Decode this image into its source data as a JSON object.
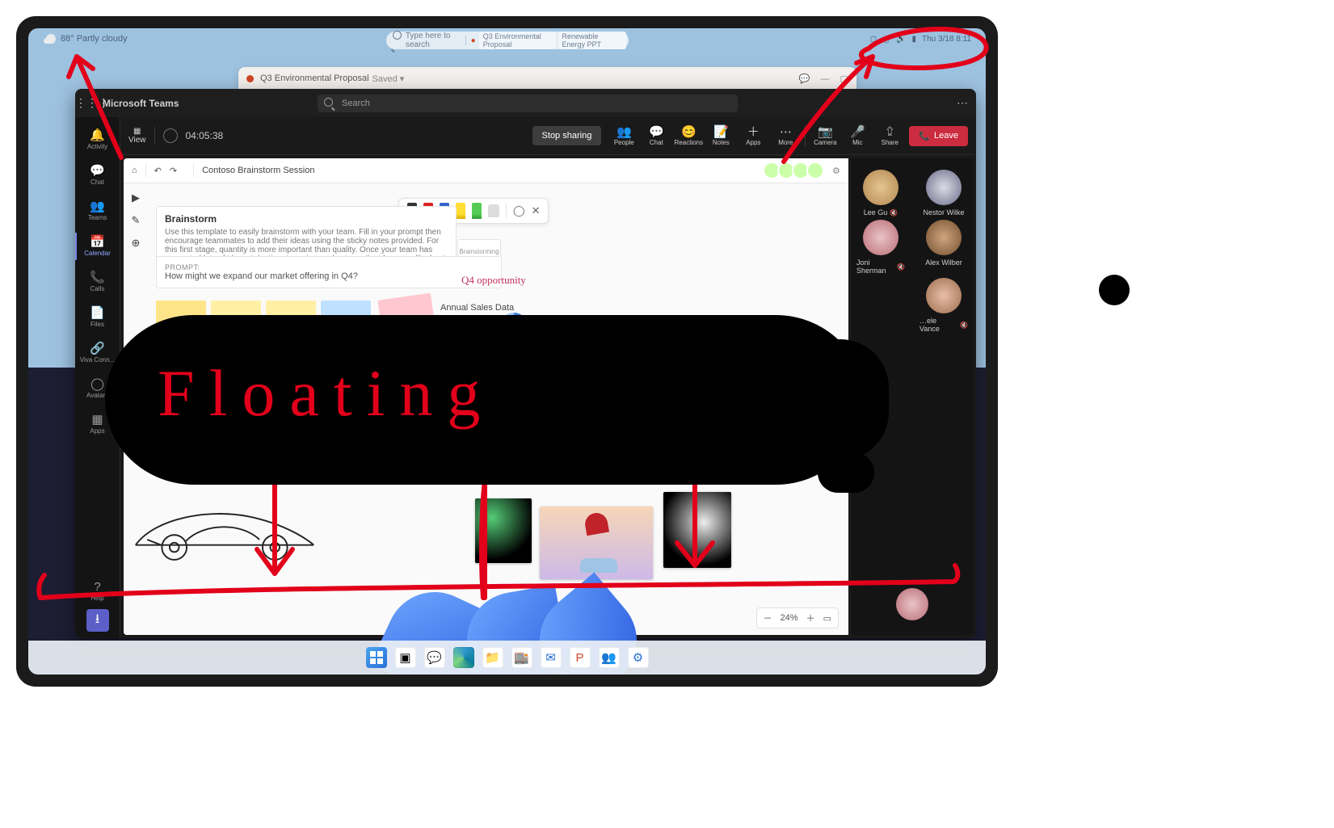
{
  "desktop": {
    "weather_text": "88° Partly cloudy",
    "search_placeholder": "Type here to search",
    "chip1": "Q3 Environmental Proposal",
    "chip2": "Renewable Energy PPT",
    "time": "Thu 3/18  8:11",
    "tray_icons": [
      "notifications",
      "wifi",
      "volume",
      "battery"
    ]
  },
  "ppt": {
    "title": "Q3 Environmental Proposal",
    "status": "Saved ▾"
  },
  "teams": {
    "app_name": "Microsoft Teams",
    "search_placeholder": "Search",
    "rail": {
      "items": [
        {
          "icon": "🔔",
          "label": "Activity"
        },
        {
          "icon": "💬",
          "label": "Chat"
        },
        {
          "icon": "👥",
          "label": "Teams"
        },
        {
          "icon": "📅",
          "label": "Calendar",
          "active": true
        },
        {
          "icon": "📞",
          "label": "Calls"
        },
        {
          "icon": "📄",
          "label": "Files"
        },
        {
          "icon": "🔗",
          "label": "Viva Conn..."
        },
        {
          "icon": "◯",
          "label": "Avatars"
        },
        {
          "icon": "▦",
          "label": "Apps"
        }
      ],
      "help": {
        "icon": "?",
        "label": "Help"
      },
      "download_icon": "⭳"
    },
    "meeting": {
      "view_label": "View",
      "timer": "04:05:38",
      "stop_sharing": "Stop sharing",
      "buttons": [
        {
          "icon": "👥",
          "label": "People"
        },
        {
          "icon": "💬",
          "label": "Chat"
        },
        {
          "icon": "😊",
          "label": "Reactions"
        },
        {
          "icon": "📝",
          "label": "Notes"
        },
        {
          "icon": "＋",
          "label": "Apps"
        },
        {
          "icon": "⋯",
          "label": "More"
        },
        {
          "icon": "📷",
          "label": "Camera"
        },
        {
          "icon": "🎤",
          "label": "Mic"
        },
        {
          "icon": "⮸",
          "label": "Share"
        }
      ],
      "leave": "Leave"
    },
    "whiteboard": {
      "title": "Contoso Brainstorm Session",
      "pens": [
        "black",
        "red",
        "blue",
        "yellow",
        "green"
      ],
      "brainstorm_heading": "Brainstorm",
      "brainstorm_body": "Use this template to easily brainstorm with your team. Fill in your prompt then encourage teammates to add their ideas using the sticky notes provided. For this first stage, quantity is more important than quality. Once your team has generated lots of ideas, take time to review and vote on the ideas you like best.",
      "mini_tab": "Brainstorming",
      "prompt_label": "PROMPT:",
      "prompt_text": "How might we expand our market offering in Q4?",
      "handwriting_q4": "Q4 opportunity",
      "sales_label": "Annual Sales Data",
      "zoom": "24%"
    },
    "participants": [
      {
        "name": "Lee Gu",
        "muted": true,
        "cls": "av1"
      },
      {
        "name": "Nestor Wilke",
        "muted": false,
        "cls": "av2"
      },
      {
        "name": "Joni Sherman",
        "muted": true,
        "cls": "av3"
      },
      {
        "name": "Alex Wilber",
        "muted": false,
        "cls": "av4"
      },
      {
        "name": "",
        "muted": false,
        "cls": "av5",
        "hidden": true
      },
      {
        "name": "…ele Vance",
        "muted": true,
        "cls": "av6"
      }
    ],
    "self_cls": "av3"
  },
  "taskbar": {
    "icons": [
      "windows",
      "task-view",
      "chat",
      "edge",
      "file-explorer",
      "store",
      "mail",
      "powerpoint",
      "teams",
      "settings"
    ]
  },
  "annotation": {
    "handwritten": "Floating"
  },
  "icons": {
    "home": "⌂",
    "undo": "↶",
    "redo": "↷",
    "gear": "⚙",
    "lasso": "◯",
    "close": "✕",
    "play": "▶",
    "pencil": "✎",
    "plus_circle": "⊕",
    "zoom_out": "－",
    "zoom_in": "＋",
    "fit": "▭",
    "phone_down": "📞"
  }
}
